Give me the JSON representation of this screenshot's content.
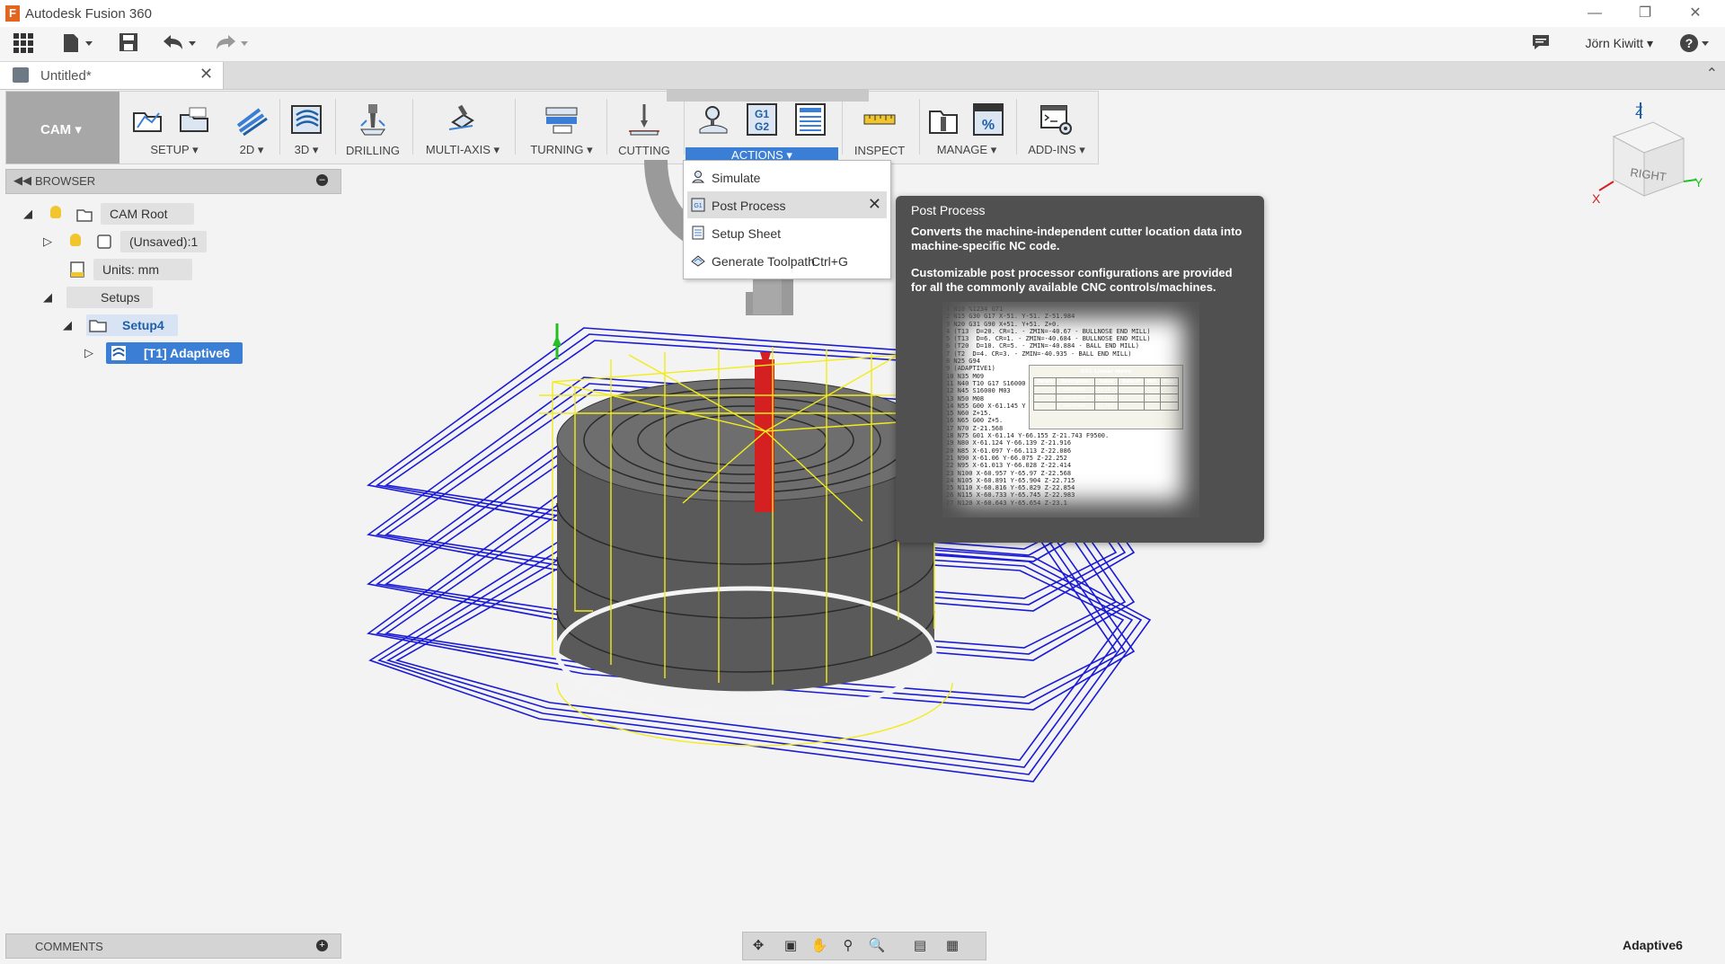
{
  "window": {
    "title": "Autodesk Fusion 360",
    "logo_letter": "F"
  },
  "qat": {
    "user_name": "Jörn Kiwitt ▾",
    "help": "?"
  },
  "doc_tab": {
    "label": "Untitled*",
    "close": "✕"
  },
  "ribbon": {
    "workspace": "CAM ▾",
    "groups": [
      {
        "label": "SETUP ▾"
      },
      {
        "label": "2D ▾"
      },
      {
        "label": "3D ▾"
      },
      {
        "label": "DRILLING"
      },
      {
        "label": "MULTI-AXIS ▾"
      },
      {
        "label": "TURNING ▾"
      },
      {
        "label": "CUTTING"
      },
      {
        "label": "ACTIONS ▾"
      },
      {
        "label": "INSPECT"
      },
      {
        "label": "MANAGE ▾"
      },
      {
        "label": "ADD-INS ▾"
      }
    ],
    "g_code_glyph_1": "G1",
    "g_code_glyph_2": "G2",
    "percent_glyph": "%"
  },
  "browser": {
    "label": "BROWSER",
    "nodes": [
      {
        "label": "CAM Root"
      },
      {
        "label": "(Unsaved):1"
      },
      {
        "label": "Units: mm"
      },
      {
        "label": "Setups"
      },
      {
        "label": "Setup4"
      },
      {
        "label": "[T1] Adaptive6"
      }
    ]
  },
  "actions_menu": {
    "items": [
      {
        "label": "Simulate",
        "shortcut": ""
      },
      {
        "label": "Post Process",
        "shortcut": ""
      },
      {
        "label": "Setup Sheet",
        "shortcut": ""
      },
      {
        "label": "Generate Toolpath",
        "shortcut": "Ctrl+G"
      }
    ]
  },
  "tooltip": {
    "title": "Post Process",
    "p1": "Converts the machine-independent cutter location data into machine-specific NC code.",
    "p2": "Customizable post processor configurations are provided for all the commonly available CNC controls/machines.",
    "code_preview": "1 N10 %1234 G71\n2 N15 G30 G17 X-51. Y-51. Z-51.984\n3 N20 G31 G90 X+51. Y+51. Z+0.\n4 (T13  D=20. CR=1. - ZMIN=-40.67 - BULLNOSE END MILL)\n5 (T13  D=6. CR=1. - ZMIN=-40.684 - BULLNOSE END MILL)\n6 (T20  D=10. CR=5. - ZMIN=-40.884 - BALL END MILL)\n7 (T2  D=4. CR=3. - ZMIN=-40.935 - BALL END MILL)\n8 N25 G94\n9 (ADAPTIVE1)\n10 N35 M09\n11 N40 T10 G17 S16000\n12 N45 S16000 M03\n13 N50 M08\n14 N55 G00 X-61.145 Y\n15 N60 Z+15.\n16 N65 G00 Z+5.\n17 N70 Z-21.568\n18 N75 G01 X-61.14 Y-66.155 Z-21.743 F9500.\n19 N80 X-61.124 Y-66.139 Z-21.916\n20 N85 X-61.097 Y-66.113 Z-22.086\n21 N90 X-61.06 Y-66.075 Z-22.252\n22 N95 X-61.013 Y-66.028 Z-22.414\n23 N100 X-60.957 Y-65.97 Z-22.568\n24 N105 X-60.891 Y-65.904 Z-22.715\n25 N110 X-60.816 Y-65.829 Z-22.854\n26 N115 X-60.733 Y-65.745 Z-22.983\n27 N120 X-60.643 Y-65.654 Z-23.1",
    "table_title": "G01 Linear move",
    "table_headers": [
      "Param",
      "Description",
      "Value",
      "Default",
      "Min.",
      "Max."
    ],
    "table_rows": [
      [
        "X",
        "X coordinate",
        "-61.14",
        "",
        "",
        ""
      ],
      [
        "Y",
        "Y coordinate",
        "-66.155",
        "",
        "",
        ""
      ],
      [
        "Z",
        "Z coordinate",
        "-21.743",
        "",
        "",
        ""
      ]
    ]
  },
  "viewcube": {
    "face": "RIGHT",
    "x": "X",
    "y": "Y",
    "z": "Z"
  },
  "comments": {
    "label": "COMMENTS"
  },
  "status": {
    "selection": "Adaptive6"
  }
}
